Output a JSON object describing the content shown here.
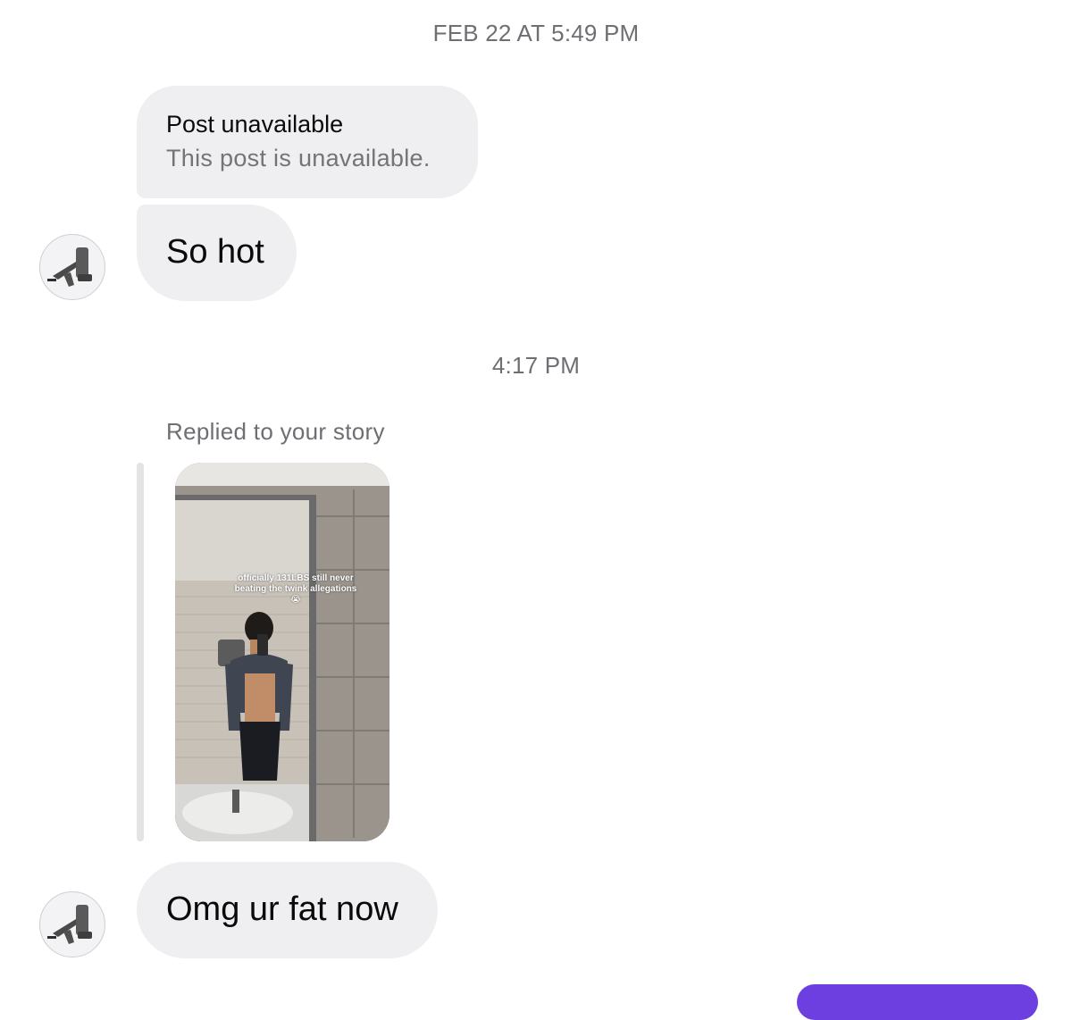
{
  "thread": {
    "timestamp_1": "FEB 22 AT 5:49 PM",
    "timestamp_2": "4:17 PM",
    "shared_post": {
      "title": "Post unavailable",
      "subtitle": "This post is unavailable."
    },
    "message_1": "So hot",
    "reply_label": "Replied to your story",
    "story_caption": "officially 131LBS still never beating the twink allegations 😭",
    "message_2": "Omg ur fat now"
  },
  "icons": {
    "avatar_1": "glue-gun-avatar-icon",
    "avatar_2": "glue-gun-avatar-icon"
  },
  "colors": {
    "bubble": "#efeff1",
    "timestamp_text": "#6e6e73",
    "accent": "#6d3fe0"
  }
}
